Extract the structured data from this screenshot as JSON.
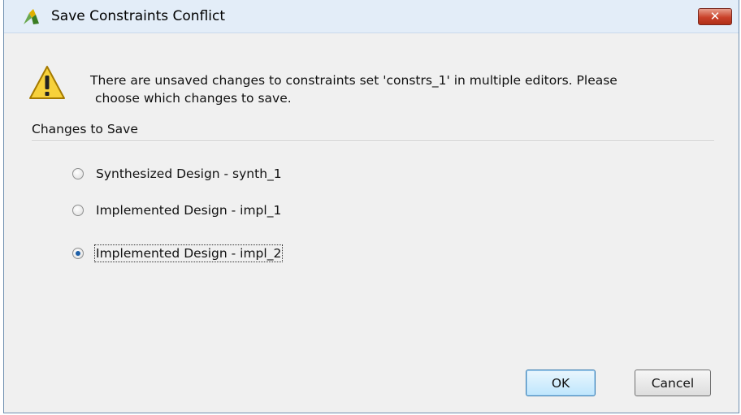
{
  "window": {
    "title": "Save Constraints Conflict",
    "close_label": "✕",
    "accent": "#c9412a"
  },
  "message": {
    "line1": "There are unsaved changes to constraints set 'constrs_1' in multiple editors. Please",
    "line2": "choose which changes to save.",
    "icon": "warning-icon"
  },
  "section": {
    "label": "Changes to Save"
  },
  "options": [
    {
      "label": "Synthesized Design - synth_1",
      "checked": false
    },
    {
      "label": "Implemented Design - impl_1",
      "checked": false
    },
    {
      "label": "Implemented Design - impl_2",
      "checked": true
    }
  ],
  "buttons": {
    "ok": "OK",
    "cancel": "Cancel"
  }
}
